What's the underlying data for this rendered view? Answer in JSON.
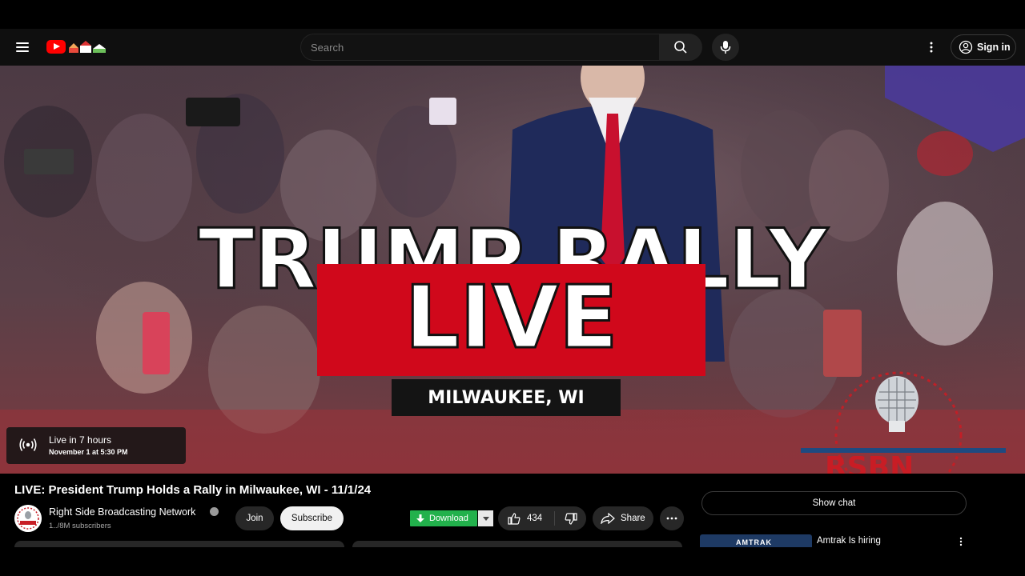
{
  "header": {
    "search_placeholder": "Search",
    "signin_label": "Sign in"
  },
  "player": {
    "headline": "TRUMP RALLY",
    "live_label": "LIVE",
    "location": "MILWAUKEE, WI",
    "live_status": "Live in 7 hours",
    "live_time": "November 1 at 5:30 PM",
    "watermark": "RSBN"
  },
  "video": {
    "title": "LIVE: President Trump Holds a Rally in Milwaukee, WI - 11/1/24",
    "channel_name": "Right Side Broadcasting Network",
    "subscribers": "1../8M subscribers",
    "join_label": "Join",
    "subscribe_label": "Subscribe",
    "download_label": "Download",
    "like_count": "434",
    "share_label": "Share"
  },
  "sidebar": {
    "show_chat_label": "Show chat",
    "ad_brand": "AMTRAK",
    "ad_title": "Amtrak Is hiring"
  },
  "colors": {
    "brand_red": "#ff0000",
    "live_red": "#d0081b",
    "download_green": "#22b14c",
    "background": "#0f0f0f"
  }
}
